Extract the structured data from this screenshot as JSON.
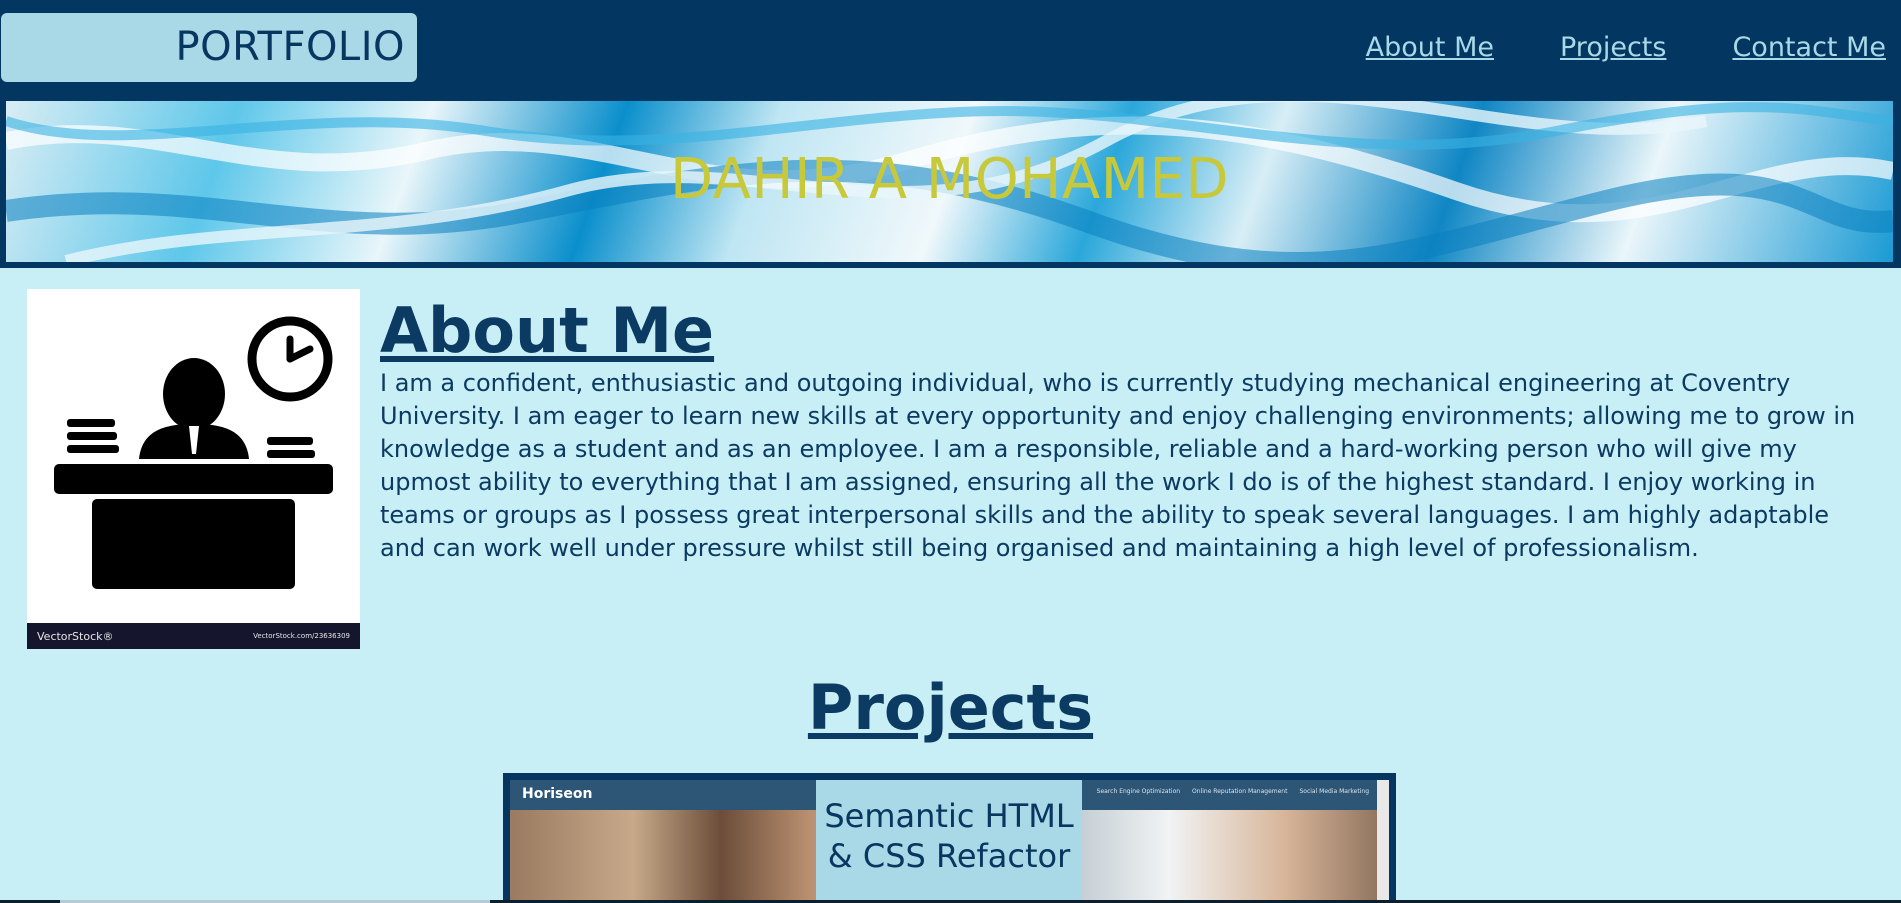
{
  "header": {
    "logo_text": "PORTFOLIO",
    "nav": [
      {
        "label": "About Me"
      },
      {
        "label": "Projects"
      },
      {
        "label": "Contact Me"
      }
    ]
  },
  "hero": {
    "name": "DAHIR A MOHAMED"
  },
  "about": {
    "title": "About Me",
    "paragraph": "I am a confident, enthusiastic and outgoing individual, who is currently studying mechanical engineering at Coventry University. I am eager to learn new skills at every opportunity and enjoy challenging environments; allowing me to grow in knowledge as a student and as an employee. I am a responsible, reliable and a hard-working person who will give my upmost ability to everything that I am assigned, ensuring all the work I do is of the highest standard. I enjoy working in teams or groups as I possess great interpersonal skills and the ability to speak several languages. I am highly adaptable and can work well under pressure whilst still being organised and maintaining a high level of professionalism.",
    "image": {
      "icon": "receptionist-desk-clock-icon",
      "watermark_left": "VectorStock®",
      "watermark_right": "VectorStock.com/23636309"
    }
  },
  "projects": {
    "title": "Projects",
    "items": [
      {
        "label": "Semantic HTML & CSS Refactor",
        "preview_brand": "Horiseon",
        "preview_nav": [
          "Search Engine Optimization",
          "Online Reputation Management",
          "Social Media Marketing"
        ]
      }
    ]
  },
  "colors": {
    "page_bg": "#c8eff6",
    "header_bg": "#033761",
    "logo_bg": "#a9d9e6",
    "hero_title": "#c7c93a",
    "text": "#0b3a62"
  }
}
